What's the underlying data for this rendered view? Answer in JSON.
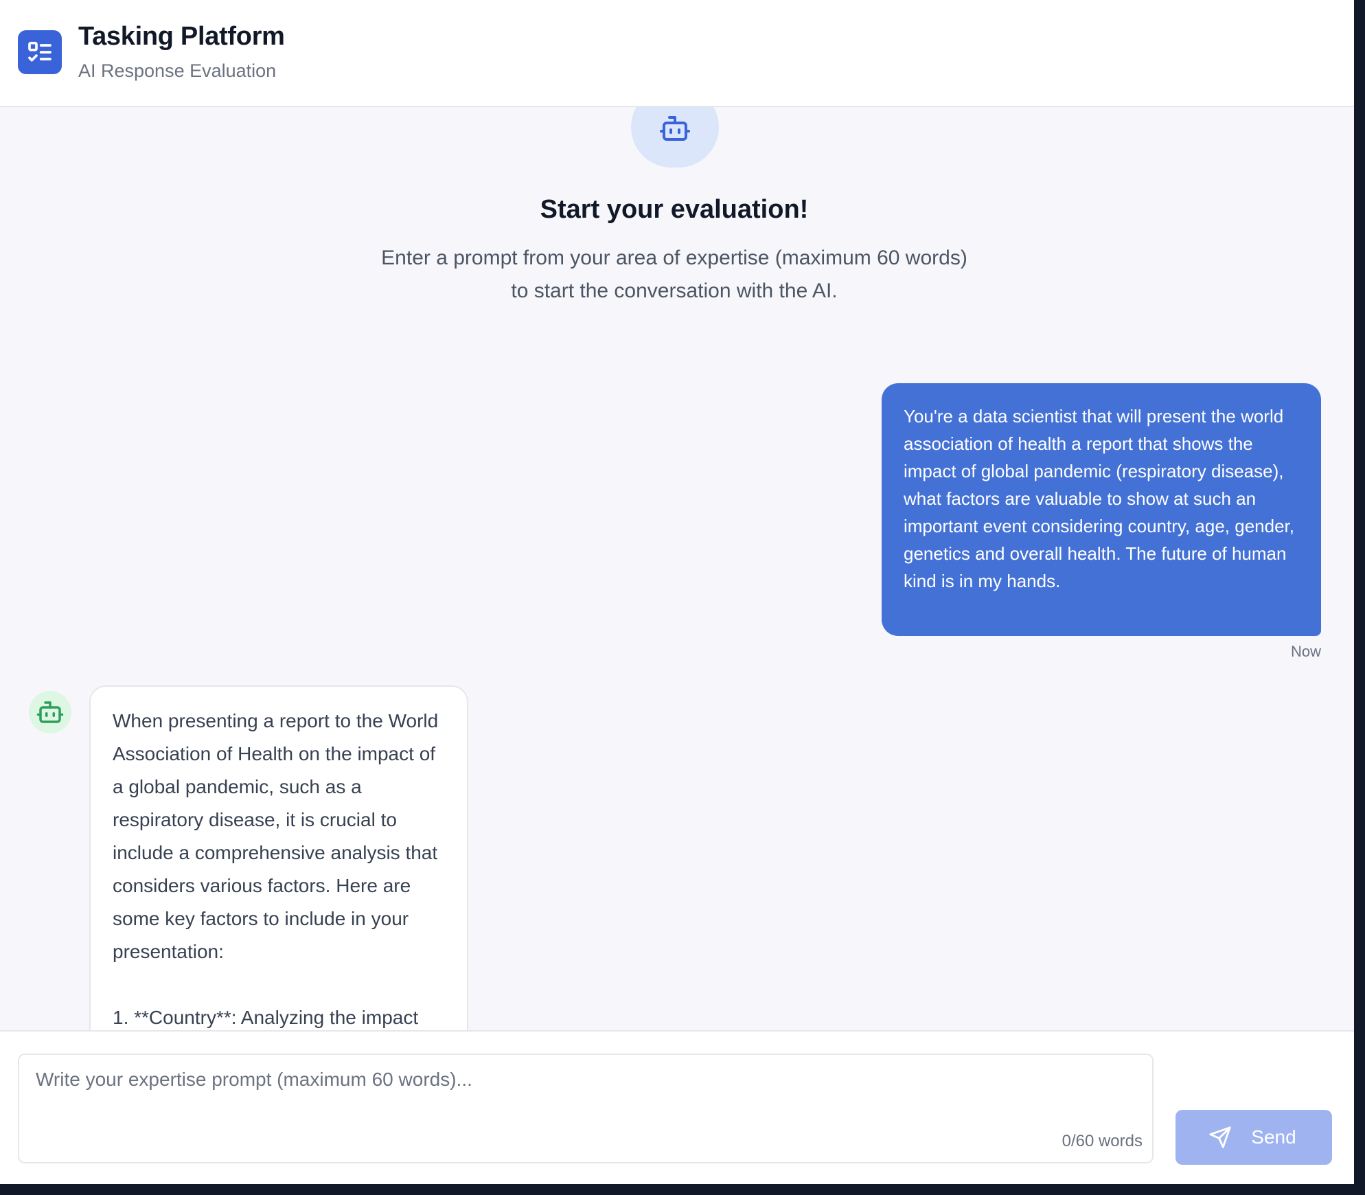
{
  "header": {
    "title": "Tasking Platform",
    "subtitle": "AI Response Evaluation",
    "logo_icon": "checklist-icon",
    "logo_color": "#3b63d9"
  },
  "intro": {
    "icon": "robot-icon",
    "title": "Start your evaluation!",
    "description": "Enter a prompt from your area of expertise (maximum 60 words) to start the conversation with the AI."
  },
  "messages": [
    {
      "role": "user",
      "text": "You're a data scientist that will present the world association of health a report that shows the impact of global pandemic (respiratory disease), what factors are valuable to show at such an important event considering country, age, gender, genetics and overall health. The future of human kind is in my hands.",
      "time": "Now",
      "color": "#4471d5"
    },
    {
      "role": "assistant",
      "avatar_icon": "robot-icon",
      "text": "When presenting a report to the World Association of Health on the impact of a global pandemic, such as a respiratory disease, it is crucial to include a comprehensive analysis that considers various factors. Here are some key factors to include in your presentation:\n\n1. **Country**: Analyzing the impact"
    }
  ],
  "composer": {
    "placeholder": "Write your expertise prompt (maximum 60 words)...",
    "value": "",
    "word_count": "0/60 words",
    "send_label": "Send",
    "send_icon": "send-icon",
    "send_color": "#9fb3f0"
  }
}
